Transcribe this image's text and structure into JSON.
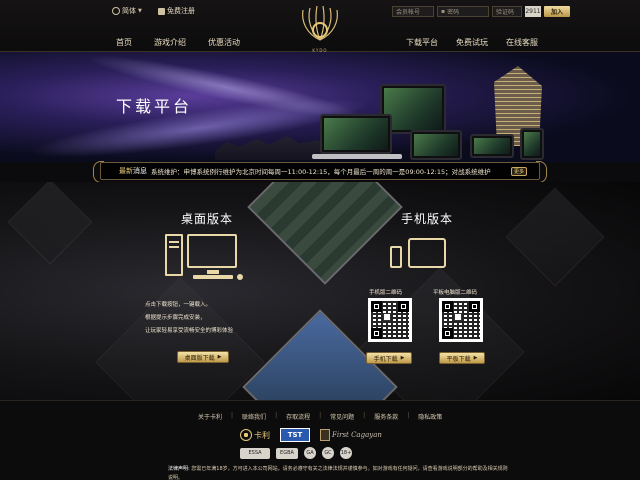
{
  "header": {
    "lang_label": "简体",
    "free_register": "免费注册",
    "login": {
      "username_placeholder": "会员帐号",
      "password_placeholder": "密码",
      "captcha_placeholder": "验证码",
      "captcha_code": "2911",
      "join_label": "加入"
    },
    "nav_left": [
      "首页",
      "游戏介绍",
      "优惠活动"
    ],
    "nav_right": [
      "下载平台",
      "免费试玩",
      "在线客服"
    ],
    "logo_text": "卡利",
    "logo_sub": "KYDO"
  },
  "banner": {
    "title": "下载平台"
  },
  "news": {
    "label_prefix": "最新",
    "label_suffix": "消息",
    "text": "系统维护：申博系统例行维护为北京时间每周一11:00-12:15，每个月最后一周的周一是09:00-12:15；对战系统维护",
    "more_label": "更多"
  },
  "desktop": {
    "title": "桌面版本",
    "desc_lines": [
      "点击下载按钮，一键载入。",
      "根据提示步骤完成安装，",
      "让玩家轻易享受流畅安全的博彩体验"
    ],
    "button_label": "桌面版下载"
  },
  "mobile": {
    "title": "手机版本",
    "qr1_label": "手机版二维码",
    "qr2_label": "平板电脑版二维码",
    "btn1_label": "手机下载",
    "btn2_label": "平板下载"
  },
  "footer": {
    "links": [
      "关于卡利",
      "联络我们",
      "存取流程",
      "常见问题",
      "服务条款",
      "隐私政策"
    ],
    "logos": {
      "kali": "卡利",
      "tst": "TST",
      "first": "First Cagayan"
    },
    "badges": [
      "ESSA",
      "EGBA",
      "GA",
      "GC",
      "18+"
    ],
    "disclaimer_label": "法律声明:",
    "disclaimer_text": "您需已年满18岁，方可进入本公司网站，请务必遵守有关之法律法规并谨慎参与。如对游戏有任何疑问，请查看游戏说明部分的帮助及相关规则说明。"
  },
  "colors": {
    "gold": "#e8c97a",
    "background": "#0b0a0c",
    "button_gold": "#c09a4a"
  }
}
